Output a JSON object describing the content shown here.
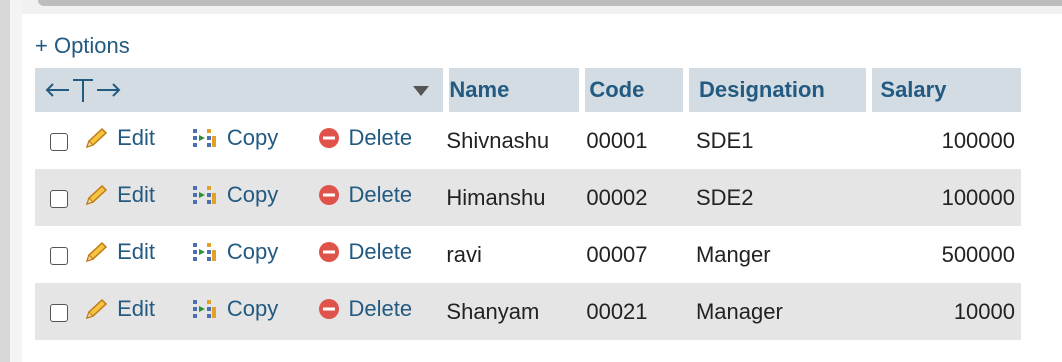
{
  "options_label": "+ Options",
  "header": {
    "arrows_label": "←T→",
    "columns": [
      "Name",
      "Code",
      "Designation",
      "Salary"
    ]
  },
  "actions": {
    "edit": "Edit",
    "copy": "Copy",
    "delete": "Delete"
  },
  "rows": [
    {
      "name": "Shivnashu",
      "code": "00001",
      "designation": "SDE1",
      "salary": "100000"
    },
    {
      "name": "Himanshu",
      "code": "00002",
      "designation": "SDE2",
      "salary": "100000"
    },
    {
      "name": "ravi",
      "code": "00007",
      "designation": "Manger",
      "salary": "500000"
    },
    {
      "name": "Shanyam",
      "code": "00021",
      "designation": "Manager",
      "salary": "10000"
    }
  ],
  "colors": {
    "link": "#235a81",
    "header_bg": "#d3dce3",
    "row_alt_bg": "#e5e5e5",
    "delete_icon": "#e0534a",
    "edit_icon": "#e8a33a"
  }
}
